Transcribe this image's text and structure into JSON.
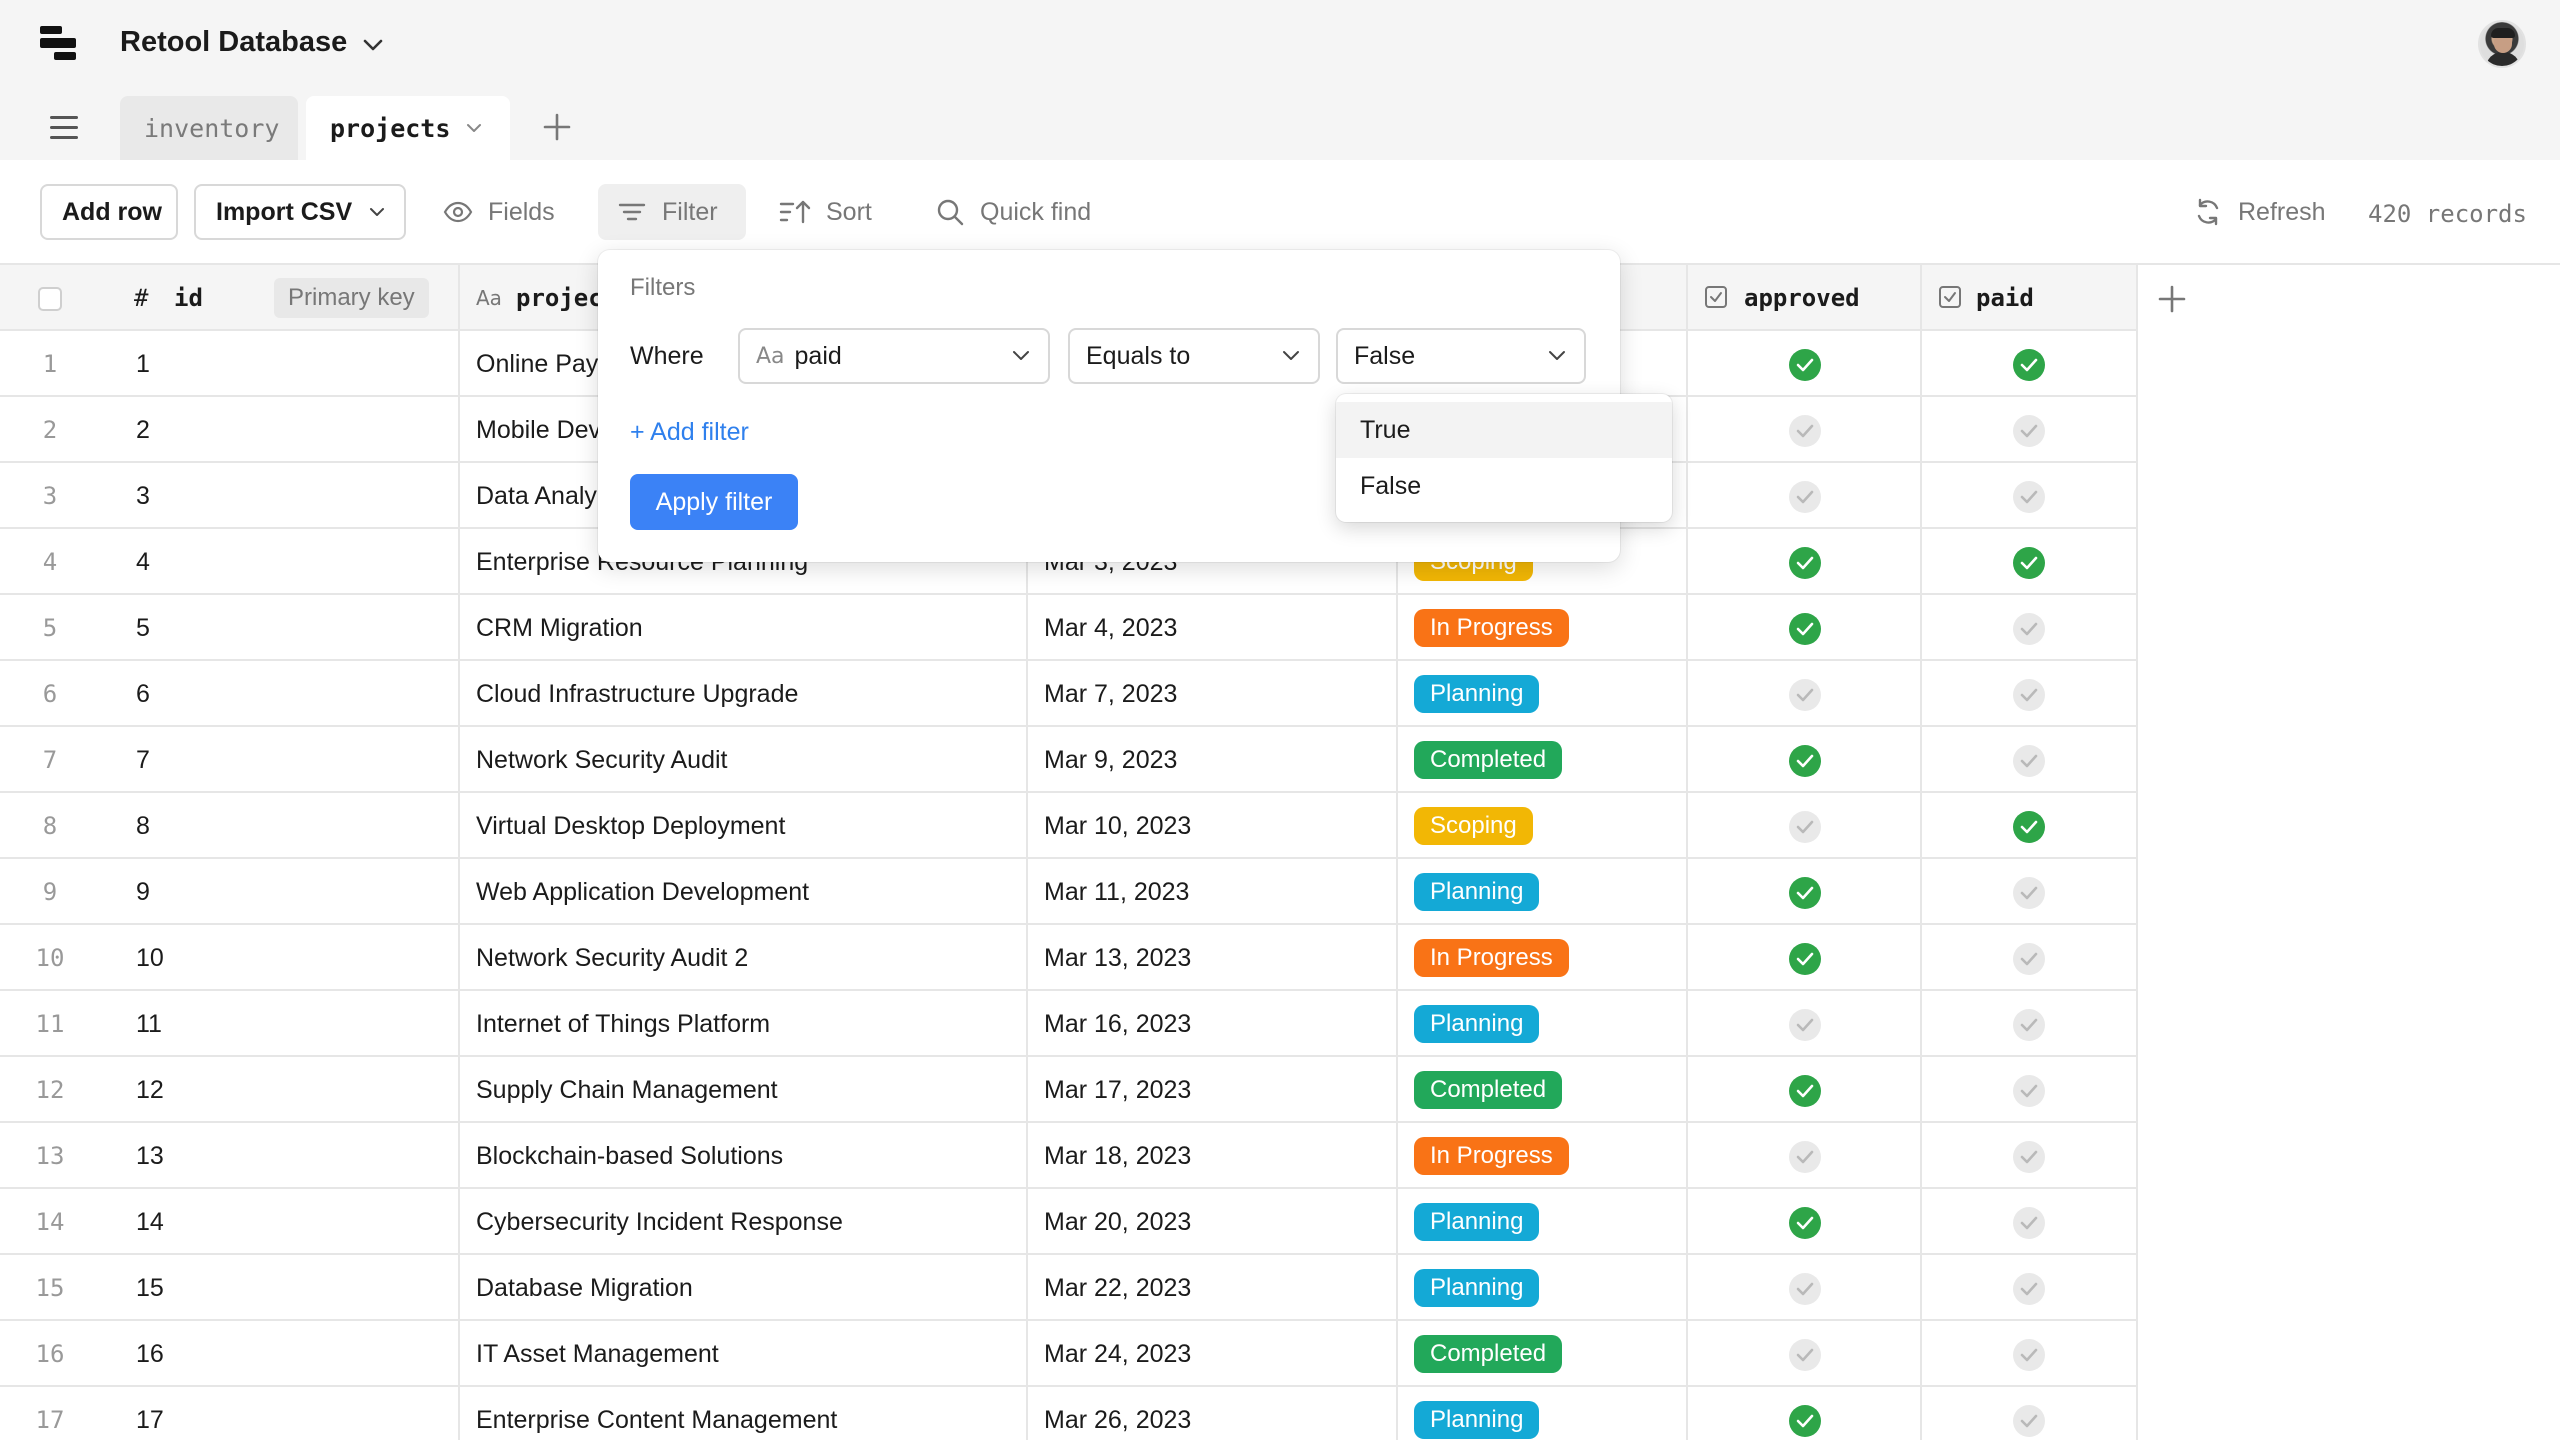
{
  "app": {
    "title": "Retool Database"
  },
  "tabs": [
    {
      "label": "inventory"
    },
    {
      "label": "projects"
    }
  ],
  "toolbar": {
    "add_row": "Add row",
    "import_csv": "Import CSV",
    "fields": "Fields",
    "filter": "Filter",
    "sort": "Sort",
    "quick_find": "Quick find",
    "refresh": "Refresh",
    "records": "420 records"
  },
  "columns": {
    "id": "id",
    "id_badge": "Primary key",
    "name": "projec",
    "approved": "approved",
    "paid": "paid",
    "type_number": "#",
    "type_text": "Aa"
  },
  "filter": {
    "title": "Filters",
    "where": "Where",
    "field_type": "Aa",
    "field": "paid",
    "operator": "Equals to",
    "value": "False",
    "add_filter": "+ Add filter",
    "apply": "Apply filter",
    "options": [
      "True",
      "False"
    ]
  },
  "status_colors": {
    "Scoping": "#f2b705",
    "In Progress": "#f97316",
    "Planning": "#14a9d6",
    "Completed": "#22a85a"
  },
  "rows": [
    {
      "n": "1",
      "id": "1",
      "name": "Online Pay",
      "date": "",
      "status": "",
      "approved": true,
      "paid": true
    },
    {
      "n": "2",
      "id": "2",
      "name": "Mobile Dev",
      "date": "",
      "status": "",
      "approved": false,
      "paid": false
    },
    {
      "n": "3",
      "id": "3",
      "name": "Data Analy",
      "date": "",
      "status": "",
      "approved": false,
      "paid": false
    },
    {
      "n": "4",
      "id": "4",
      "name": "Enterprise Resource Planning",
      "date": "Mar 3, 2023",
      "status": "Scoping",
      "approved": true,
      "paid": true
    },
    {
      "n": "5",
      "id": "5",
      "name": "CRM Migration",
      "date": "Mar 4, 2023",
      "status": "In Progress",
      "approved": true,
      "paid": false
    },
    {
      "n": "6",
      "id": "6",
      "name": "Cloud Infrastructure Upgrade",
      "date": "Mar 7, 2023",
      "status": "Planning",
      "approved": false,
      "paid": false
    },
    {
      "n": "7",
      "id": "7",
      "name": "Network Security Audit",
      "date": "Mar 9, 2023",
      "status": "Completed",
      "approved": true,
      "paid": false
    },
    {
      "n": "8",
      "id": "8",
      "name": "Virtual Desktop Deployment",
      "date": "Mar 10, 2023",
      "status": "Scoping",
      "approved": false,
      "paid": true
    },
    {
      "n": "9",
      "id": "9",
      "name": "Web Application Development",
      "date": "Mar 11, 2023",
      "status": "Planning",
      "approved": true,
      "paid": false
    },
    {
      "n": "10",
      "id": "10",
      "name": "Network Security Audit 2",
      "date": "Mar 13, 2023",
      "status": "In Progress",
      "approved": true,
      "paid": false
    },
    {
      "n": "11",
      "id": "11",
      "name": "Internet of Things Platform",
      "date": "Mar 16, 2023",
      "status": "Planning",
      "approved": false,
      "paid": false
    },
    {
      "n": "12",
      "id": "12",
      "name": "Supply Chain Management",
      "date": "Mar 17, 2023",
      "status": "Completed",
      "approved": true,
      "paid": false
    },
    {
      "n": "13",
      "id": "13",
      "name": "Blockchain-based Solutions",
      "date": "Mar 18, 2023",
      "status": "In Progress",
      "approved": false,
      "paid": false
    },
    {
      "n": "14",
      "id": "14",
      "name": "Cybersecurity Incident Response",
      "date": "Mar 20, 2023",
      "status": "Planning",
      "approved": true,
      "paid": false
    },
    {
      "n": "15",
      "id": "15",
      "name": "Database Migration",
      "date": "Mar 22, 2023",
      "status": "Planning",
      "approved": false,
      "paid": false
    },
    {
      "n": "16",
      "id": "16",
      "name": "IT Asset Management",
      "date": "Mar 24, 2023",
      "status": "Completed",
      "approved": false,
      "paid": false
    },
    {
      "n": "17",
      "id": "17",
      "name": "Enterprise Content Management",
      "date": "Mar 26, 2023",
      "status": "Planning",
      "approved": true,
      "paid": false
    }
  ]
}
